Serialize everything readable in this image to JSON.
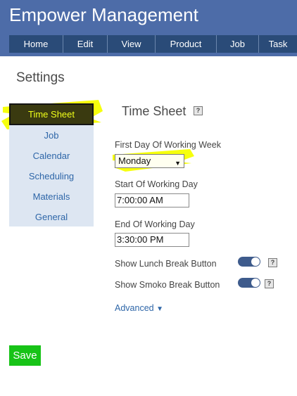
{
  "header": {
    "app_title": "Empower Management",
    "nav": [
      "Home",
      "Edit",
      "View",
      "Product",
      "Job",
      "Task"
    ]
  },
  "page": {
    "title": "Settings"
  },
  "sidebar": {
    "items": [
      {
        "label": "Time Sheet",
        "active": true
      },
      {
        "label": "Job"
      },
      {
        "label": "Calendar"
      },
      {
        "label": "Scheduling"
      },
      {
        "label": "Materials"
      },
      {
        "label": "General"
      }
    ]
  },
  "panel": {
    "title": "Time Sheet",
    "help_glyph": "?",
    "first_day_label": "First Day Of Working Week",
    "first_day_value": "Monday",
    "start_label": "Start Of Working Day",
    "start_value": "7:00:00 AM",
    "end_label": "End Of Working Day",
    "end_value": "3:30:00 PM",
    "lunch_label": "Show Lunch Break Button",
    "lunch_on": true,
    "smoko_label": "Show Smoko Break Button",
    "smoko_on": true,
    "advanced_label": "Advanced"
  },
  "actions": {
    "save_label": "Save"
  },
  "colors": {
    "header": "#4d6ca8",
    "nav": "#2a4b78",
    "sidebar": "#dde6f2",
    "link": "#2e66a8",
    "save": "#17c317",
    "highlighter": "#f5ff00"
  }
}
